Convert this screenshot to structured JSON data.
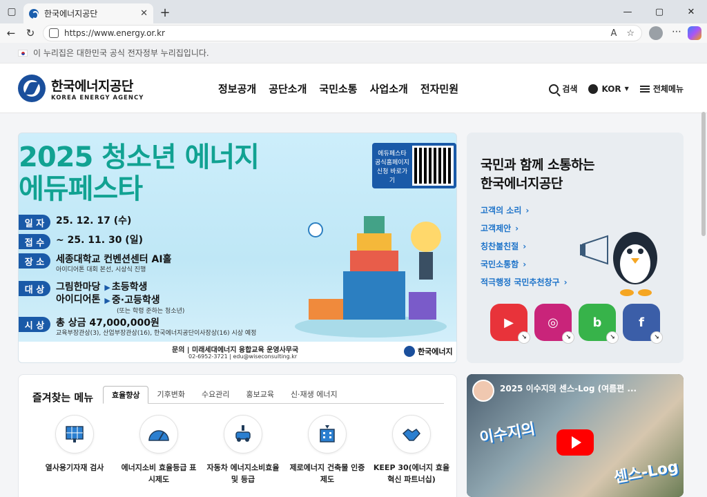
{
  "browser": {
    "tab_title": "한국에너지공단",
    "url": "https://www.energy.or.kr"
  },
  "gov_notice": "이 누리집은 대한민국 공식 전자정부 누리집입니다.",
  "logo": {
    "name_ko": "한국에너지공단",
    "name_en": "KOREA ENERGY AGENCY"
  },
  "gnb": [
    "정보공개",
    "공단소개",
    "국민소통",
    "사업소개",
    "전자민원"
  ],
  "util": {
    "search": "검색",
    "lang": "KOR",
    "all_menu": "전체메뉴"
  },
  "banner": {
    "title_line1": "2025 청소년 에너지",
    "title_line2": "에듀페스타",
    "qr_text": "에듀페스타 공식홈페이지 신청 바로가기",
    "rows": [
      {
        "label": "일 자",
        "value": "25. 12. 17 (수)"
      },
      {
        "label": "접 수",
        "value": "~ 25. 11. 30 (일)"
      },
      {
        "label": "장 소",
        "value": "세종대학교 컨벤션센터 AI홀",
        "sub": "아이디어톤 대회 본선, 시상식 진행"
      },
      {
        "label": "대 상",
        "value_a": "그림한마당",
        "value_b": "아이디어톤",
        "target_a": "초등학생",
        "target_b": "중·고등학생",
        "sub": "(또는 학령 준하는 청소년)"
      },
      {
        "label": "시 상",
        "value": "총 상금 47,000,000원",
        "sub": "교육부장관상(3), 산업부장관상(16), 한국에너지공단이사장상(16) 시상 예정"
      }
    ],
    "contact": "문의 | 미래세대에너지 융합교육 운영사무국",
    "contact_detail": "02-6952-3721  |  edu@wiseconsulting.kr",
    "footer_logo": "한국에너지"
  },
  "comms": {
    "title_line1": "국민과 함께 소통하는",
    "title_line2": "한국에너지공단",
    "links": [
      "고객의 소리",
      "고객제안",
      "칭찬불친절",
      "국민소통함",
      "적극행정 국민추천창구"
    ],
    "sns": [
      {
        "name": "youtube",
        "glyph": "▶",
        "color": "#e8333a"
      },
      {
        "name": "instagram",
        "glyph": "◎",
        "color": "#c9247a"
      },
      {
        "name": "blog",
        "glyph": "b",
        "color": "#37b34a"
      },
      {
        "name": "facebook",
        "glyph": "f",
        "color": "#3b5ea8"
      }
    ]
  },
  "favorites": {
    "title": "즐겨찾는 메뉴",
    "tabs": [
      "효율향상",
      "기후변화",
      "수요관리",
      "홍보교육",
      "신·재생 에너지"
    ],
    "items": [
      {
        "label": "열사용기자재 검사"
      },
      {
        "label": "에너지소비 효율등급 표시제도"
      },
      {
        "label": "자동차 에너지소비효율 및 등급"
      },
      {
        "label": "제로에너지 건축물 인증제도"
      },
      {
        "label": "KEEP 30(에너지 효율혁신 파트너십)"
      }
    ]
  },
  "video": {
    "title": "2025 이수지의 센스-Log (여름편 ...",
    "caption_a": "이수지의",
    "caption_b": "센스-Log"
  }
}
